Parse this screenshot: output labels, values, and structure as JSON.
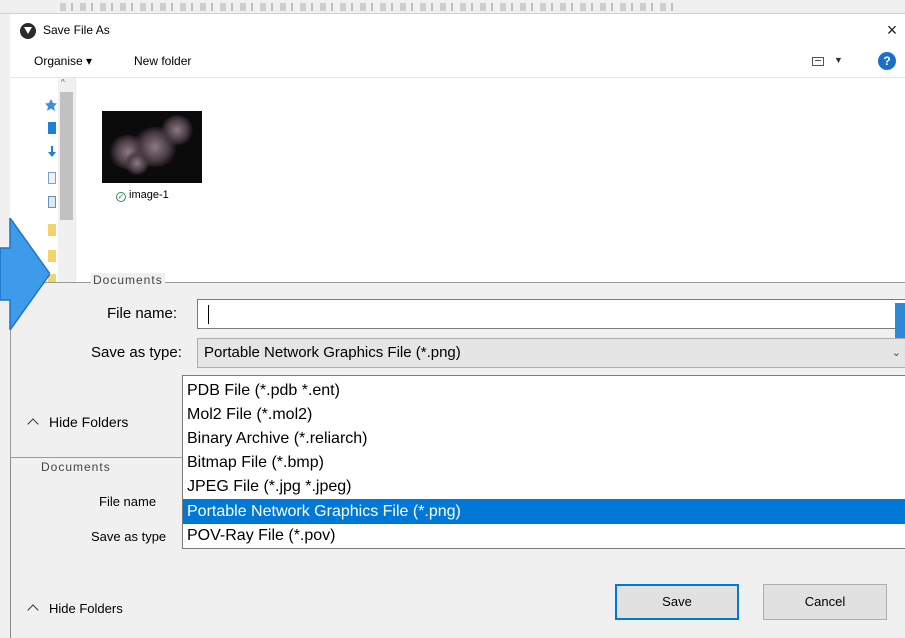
{
  "window": {
    "title": "Save File As",
    "close_glyph": "×"
  },
  "toolbar": {
    "organise": "Organise ▾",
    "new_folder": "New folder",
    "view_arrow": "▼",
    "help": "?"
  },
  "nav_pane": {
    "scroll_up": "^"
  },
  "files": [
    {
      "name": "image-1",
      "status_icon": "check-circle-icon"
    }
  ],
  "form": {
    "docs_label": "Documents",
    "file_name_label": "File name:",
    "file_name_value": "",
    "save_as_type_label": "Save as type:",
    "save_as_type_value": "Portable Network Graphics File (*.png)",
    "select_arrow": "⌄",
    "hide_folders": "Hide Folders"
  },
  "dropdown": {
    "options": [
      "PDB File (*.pdb *.ent)",
      "Mol2 File (*.mol2)",
      "Binary Archive (*.reliarch)",
      "Bitmap File (*.bmp)",
      "JPEG File (*.jpg *.jpeg)",
      "Portable Network Graphics File (*.png)",
      "POV-Ray File (*.pov)"
    ],
    "selected_index": 5
  },
  "lower_form": {
    "docs_label": "Documents",
    "file_name_label": "File name",
    "save_as_type_label": "Save as type",
    "hide_folders": "Hide Folders",
    "save_button": "Save",
    "cancel_button": "Cancel"
  },
  "colors": {
    "accent": "#0078d7",
    "help": "#1a6fc9",
    "arrow": "#3d9be9"
  }
}
